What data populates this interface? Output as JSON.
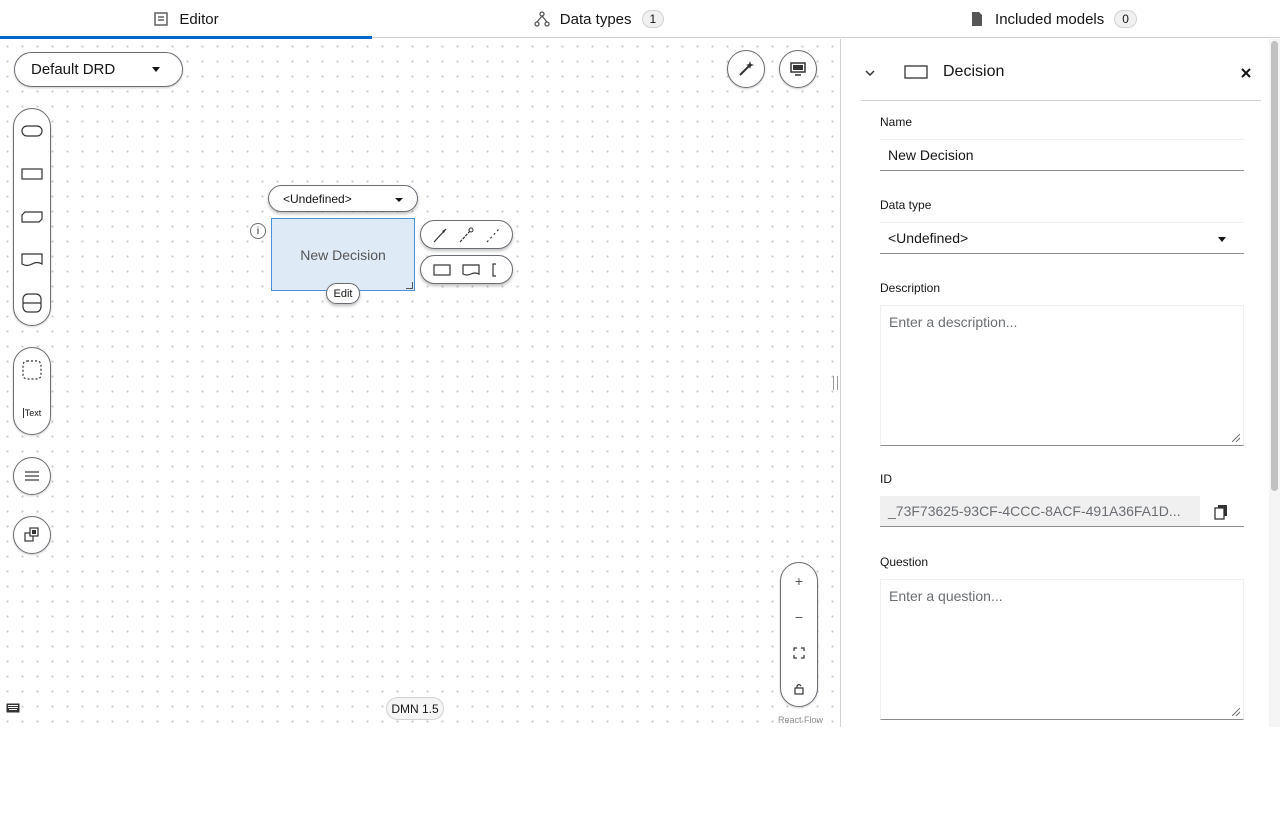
{
  "tabs": [
    {
      "label": "Editor",
      "icon": "editor-icon",
      "active": true
    },
    {
      "label": "Data types",
      "icon": "data-types-icon",
      "count": "1"
    },
    {
      "label": "Included models",
      "icon": "document-icon",
      "count": "0"
    }
  ],
  "canvas": {
    "drd_select": "Default DRD",
    "node": {
      "name": "New Decision",
      "type_select": "<Undefined>",
      "edit_label": "Edit"
    },
    "palette_text_label": "Text",
    "dmn_version": "DMN 1.5",
    "react_flow": "React Flow"
  },
  "panel": {
    "title": "Decision",
    "name_label": "Name",
    "name_value": "New Decision",
    "data_type_label": "Data type",
    "data_type_value": "<Undefined>",
    "description_label": "Description",
    "description_placeholder": "Enter a description...",
    "id_label": "ID",
    "id_value": "_73F73625-93CF-4CCC-8ACF-491A36FA1D...",
    "question_label": "Question",
    "question_placeholder": "Enter a question..."
  },
  "colors": {
    "accent": "#0066cc",
    "node_fill": "#dfeaf7",
    "node_border": "#4a90d9"
  }
}
